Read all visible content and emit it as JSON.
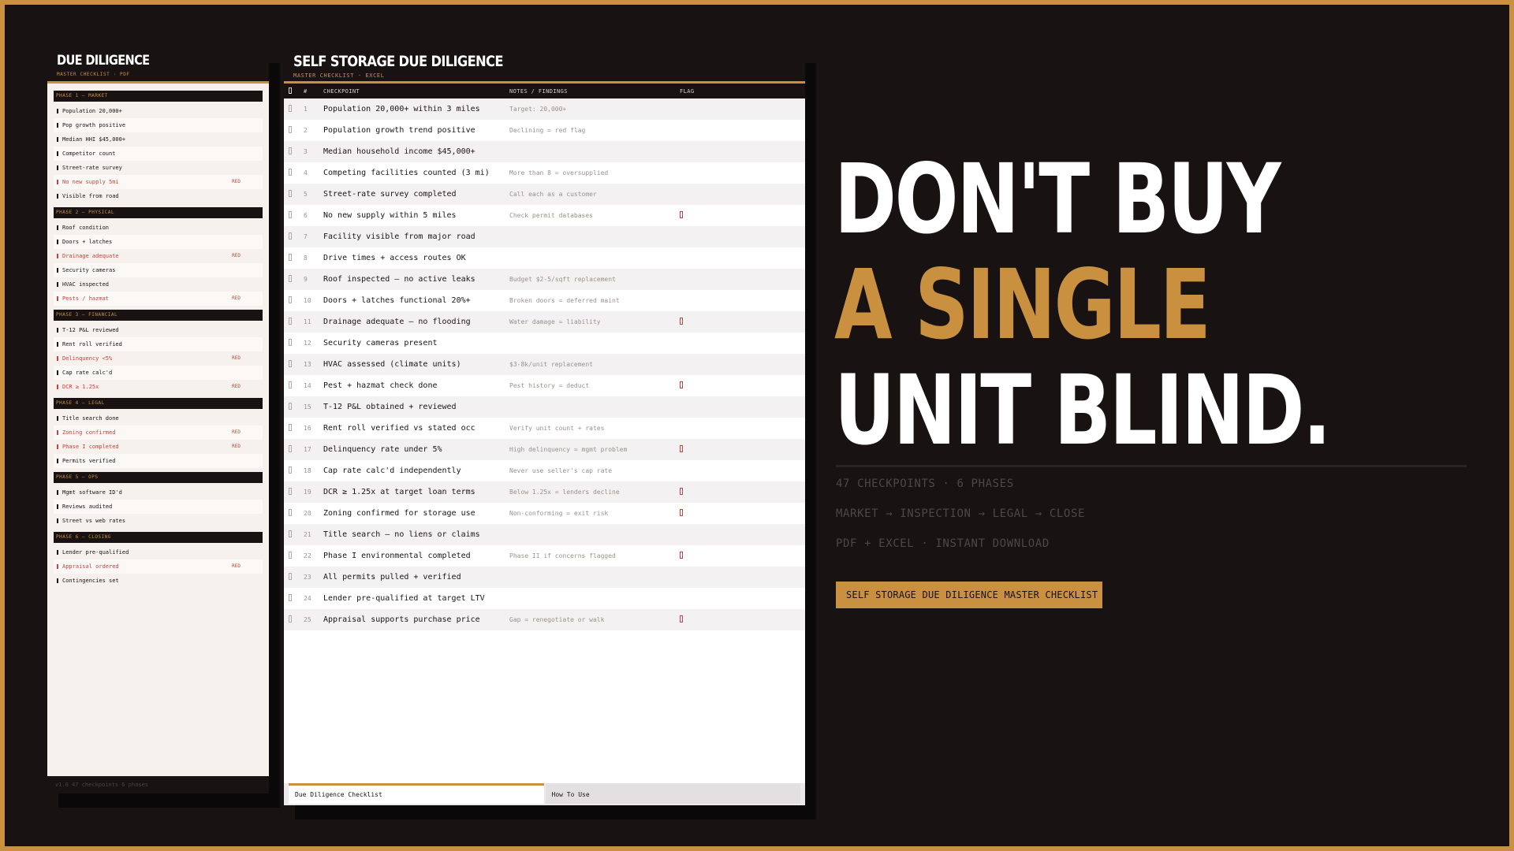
{
  "pdf": {
    "title": "DUE DILIGENCE",
    "subtitle": "MASTER CHECKLIST · PDF",
    "flag_label": "RED",
    "footer": "v1.0    47 checkpoints    6 phases",
    "phases": [
      {
        "name": "PHASE 1 — MARKET",
        "items": [
          {
            "label": "Population 20,000+",
            "flag": false
          },
          {
            "label": "Pop growth positive",
            "flag": false
          },
          {
            "label": "Median HHI $45,000+",
            "flag": false
          },
          {
            "label": "Competitor count",
            "flag": false
          },
          {
            "label": "Street-rate survey",
            "flag": false
          },
          {
            "label": "No new supply 5mi",
            "flag": true
          },
          {
            "label": "Visible from road",
            "flag": false
          }
        ]
      },
      {
        "name": "PHASE 2 — PHYSICAL",
        "items": [
          {
            "label": "Roof condition",
            "flag": false
          },
          {
            "label": "Doors + latches",
            "flag": false
          },
          {
            "label": "Drainage adequate",
            "flag": true
          },
          {
            "label": "Security cameras",
            "flag": false
          },
          {
            "label": "HVAC inspected",
            "flag": false
          },
          {
            "label": "Pests / hazmat",
            "flag": true
          }
        ]
      },
      {
        "name": "PHASE 3 — FINANCIAL",
        "items": [
          {
            "label": "T-12 P&L reviewed",
            "flag": false
          },
          {
            "label": "Rent roll verified",
            "flag": false
          },
          {
            "label": "Delinquency <5%",
            "flag": true
          },
          {
            "label": "Cap rate calc'd",
            "flag": false
          },
          {
            "label": "DCR ≥ 1.25x",
            "flag": true
          }
        ]
      },
      {
        "name": "PHASE 4 — LEGAL",
        "items": [
          {
            "label": "Title search done",
            "flag": false
          },
          {
            "label": "Zoning confirmed",
            "flag": true
          },
          {
            "label": "Phase I completed",
            "flag": true
          },
          {
            "label": "Permits verified",
            "flag": false
          }
        ]
      },
      {
        "name": "PHASE 5 — OPS",
        "items": [
          {
            "label": "Mgmt software ID'd",
            "flag": false
          },
          {
            "label": "Reviews audited",
            "flag": false
          },
          {
            "label": "Street vs web rates",
            "flag": false
          }
        ]
      },
      {
        "name": "PHASE 6 — CLOSING",
        "items": [
          {
            "label": "Lender pre-qualified",
            "flag": false
          },
          {
            "label": "Appraisal ordered",
            "flag": true
          },
          {
            "label": "Contingencies set",
            "flag": false
          }
        ]
      }
    ]
  },
  "excel": {
    "title": "SELF STORAGE DUE DILIGENCE",
    "subtitle": "MASTER CHECKLIST · EXCEL",
    "columns": {
      "num": "#",
      "checkpoint": "CHECKPOINT",
      "notes": "NOTES / FINDINGS",
      "flag": "FLAG"
    },
    "rows": [
      {
        "num": "1",
        "checkpoint": "Population 20,000+ within 3 miles",
        "note": "Target: 20,000+",
        "flag": false
      },
      {
        "num": "2",
        "checkpoint": "Population growth trend positive",
        "note": "Declining = red flag",
        "flag": false
      },
      {
        "num": "3",
        "checkpoint": "Median household income $45,000+",
        "note": "",
        "flag": false
      },
      {
        "num": "4",
        "checkpoint": "Competing facilities counted (3 mi)",
        "note": "More than 8 = oversupplied",
        "flag": false
      },
      {
        "num": "5",
        "checkpoint": "Street-rate survey completed",
        "note": "Call each as a customer",
        "flag": false
      },
      {
        "num": "6",
        "checkpoint": "No new supply within 5 miles",
        "note": "Check permit databases",
        "flag": true
      },
      {
        "num": "7",
        "checkpoint": "Facility visible from major road",
        "note": "",
        "flag": false
      },
      {
        "num": "8",
        "checkpoint": "Drive times + access routes OK",
        "note": "",
        "flag": false
      },
      {
        "num": "9",
        "checkpoint": "Roof inspected — no active leaks",
        "note": "Budget $2-5/sqft replacement",
        "flag": false
      },
      {
        "num": "10",
        "checkpoint": "Doors + latches functional 20%+",
        "note": "Broken doors = deferred maint",
        "flag": false
      },
      {
        "num": "11",
        "checkpoint": "Drainage adequate — no flooding",
        "note": "Water damage = liability",
        "flag": true
      },
      {
        "num": "12",
        "checkpoint": "Security cameras present",
        "note": "",
        "flag": false
      },
      {
        "num": "13",
        "checkpoint": "HVAC assessed (climate units)",
        "note": "$3-8k/unit replacement",
        "flag": false
      },
      {
        "num": "14",
        "checkpoint": "Pest + hazmat check done",
        "note": "Pest history = deduct",
        "flag": true
      },
      {
        "num": "15",
        "checkpoint": "T-12 P&L obtained + reviewed",
        "note": "",
        "flag": false
      },
      {
        "num": "16",
        "checkpoint": "Rent roll verified vs stated occ",
        "note": "Verify unit count + rates",
        "flag": false
      },
      {
        "num": "17",
        "checkpoint": "Delinquency rate under 5%",
        "note": "High delinquency = mgmt problem",
        "flag": true
      },
      {
        "num": "18",
        "checkpoint": "Cap rate calc'd independently",
        "note": "Never use seller's cap rate",
        "flag": false
      },
      {
        "num": "19",
        "checkpoint": "DCR ≥ 1.25x at target loan terms",
        "note": "Below 1.25x = lenders decline",
        "flag": true
      },
      {
        "num": "20",
        "checkpoint": "Zoning confirmed for storage use",
        "note": "Non-conforming = exit risk",
        "flag": true
      },
      {
        "num": "21",
        "checkpoint": "Title search — no liens or claims",
        "note": "",
        "flag": false
      },
      {
        "num": "22",
        "checkpoint": "Phase I environmental completed",
        "note": "Phase II if concerns flagged",
        "flag": true
      },
      {
        "num": "23",
        "checkpoint": "All permits pulled + verified",
        "note": "",
        "flag": false
      },
      {
        "num": "24",
        "checkpoint": "Lender pre-qualified at target LTV",
        "note": "",
        "flag": false
      },
      {
        "num": "25",
        "checkpoint": "Appraisal supports purchase price",
        "note": "Gap = renegotiate or walk",
        "flag": true
      }
    ],
    "tabs": [
      "Due Diligence Checklist",
      "How To Use"
    ]
  },
  "headline": {
    "line1": "DON'T BUY",
    "line2": "A SINGLE",
    "line3": "UNIT BLIND."
  },
  "meta": {
    "line1": "47 CHECKPOINTS  ·  6 PHASES",
    "line2": "MARKET → INSPECTION → LEGAL → CLOSE",
    "line3": "PDF + EXCEL  ·  INSTANT DOWNLOAD"
  },
  "cta_label": "SELF STORAGE DUE DILIGENCE MASTER CHECKLIST",
  "colors": {
    "accent": "#c9913f",
    "background": "#181213",
    "flag_red": "#c0453f"
  }
}
